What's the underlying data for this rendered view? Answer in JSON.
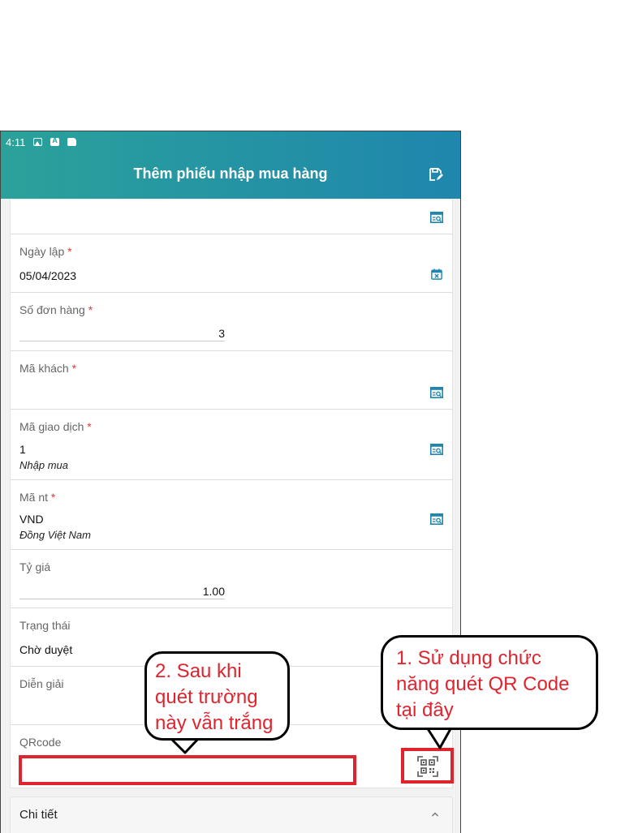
{
  "statusbar": {
    "time": "4:11"
  },
  "header": {
    "title": "Thêm phiếu nhập mua hàng"
  },
  "form": {
    "ngay_lap": {
      "label": "Ngày lập",
      "required": "*",
      "value": "05/04/2023"
    },
    "so_don_hang": {
      "label": "Số đơn hàng",
      "required": "*",
      "value": "3"
    },
    "ma_khach": {
      "label": "Mã khách",
      "required": "*",
      "value": ""
    },
    "ma_giao_dich": {
      "label": "Mã giao dịch",
      "required": "*",
      "value": "1",
      "desc": "Nhập mua"
    },
    "ma_nt": {
      "label": "Mã nt",
      "required": "*",
      "value": "VND",
      "desc": "Đồng Việt Nam"
    },
    "ty_gia": {
      "label": "Tỷ giá",
      "value": "1.00"
    },
    "trang_thai": {
      "label": "Trạng thái",
      "value": "Chờ duyệt"
    },
    "dien_giai": {
      "label": "Diễn giải",
      "value": ""
    },
    "qrcode": {
      "label": "QRcode",
      "value": ""
    }
  },
  "detail": {
    "label": "Chi tiết"
  },
  "annotations": {
    "callout1": [
      "1. Sử dụng chức",
      "năng quét QR Code",
      "tại đây"
    ],
    "callout2": [
      "2. Sau khi",
      "quét trường",
      "này vẫn trắng"
    ]
  },
  "colors": {
    "header_start": "#2aa29a",
    "header_end": "#1f86ad",
    "accent": "#1f86ad",
    "required": "#e53935",
    "highlight": "#e0242e"
  },
  "icons": {
    "save": "save-edit-icon",
    "lookup": "lookup-icon",
    "calendar": "calendar-icon",
    "qr": "qr-scan-icon",
    "chevron": "chevron-up-icon"
  }
}
